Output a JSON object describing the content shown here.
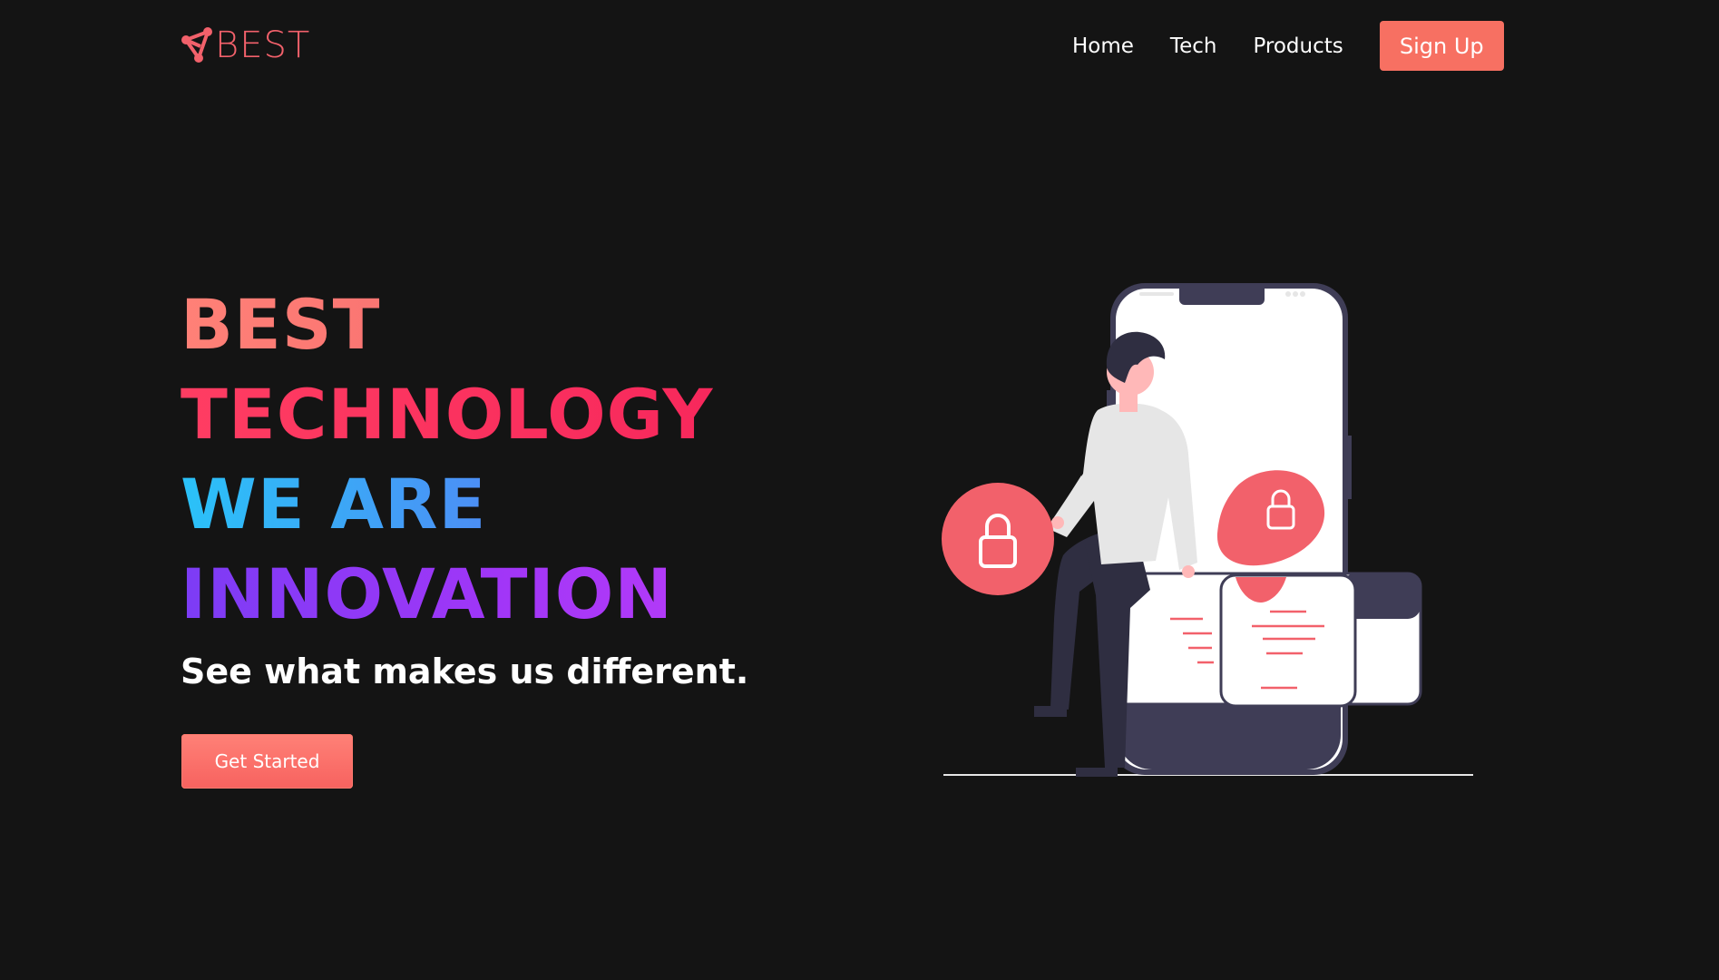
{
  "brand": {
    "name": "BEST",
    "logo_icon": "connected-nodes-icon",
    "color": "#f2616b"
  },
  "nav": {
    "items": [
      {
        "label": "Home"
      },
      {
        "label": "Tech"
      },
      {
        "label": "Products"
      }
    ],
    "signup_label": "Sign Up"
  },
  "hero": {
    "lines": [
      "BEST",
      "TECHNOLOGY",
      "WE ARE",
      "INNOVATION"
    ],
    "subtitle": "See what makes us different.",
    "cta_label": "Get Started"
  },
  "illustration": {
    "subject": "person-with-phone-security-illustration",
    "icons": [
      "lock-icon",
      "lock-icon"
    ]
  },
  "colors": {
    "background": "#141414",
    "accent": "#f77062",
    "heading_pink": "#ff3d62",
    "heading_blue": "#2ac2f8",
    "heading_purple": "#a136f7"
  }
}
